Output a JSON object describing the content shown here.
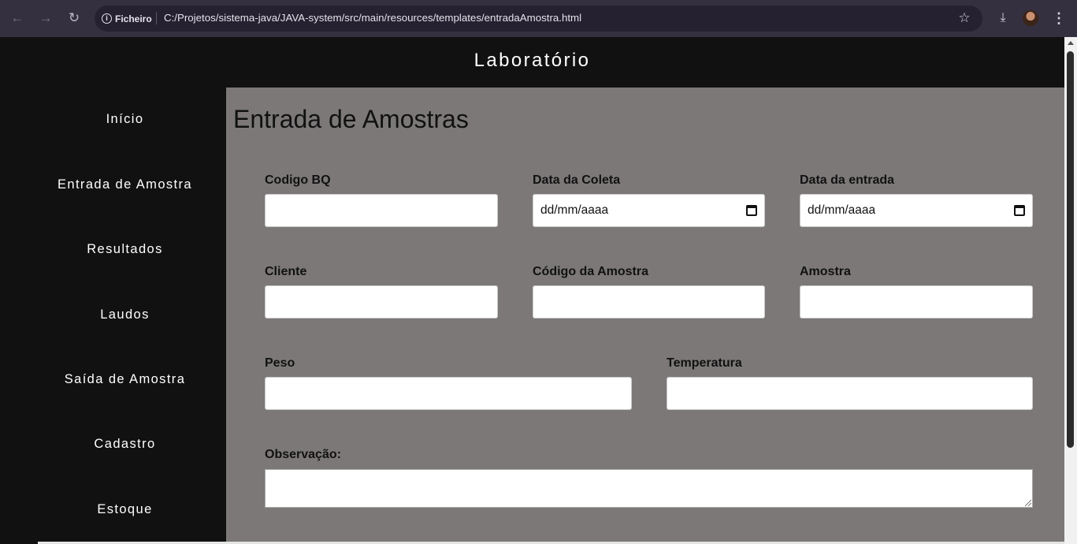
{
  "browser": {
    "site_chip": "Ficheiro",
    "url": "C:/Projetos/sistema-java/JAVA-system/src/main/resources/templates/entradaAmostra.html",
    "icons": [
      "back-arrow-icon",
      "forward-arrow-icon",
      "reload-icon",
      "info-icon",
      "star-icon",
      "download-icon",
      "profile-avatar",
      "kebab-menu-icon"
    ]
  },
  "header": {
    "title": "Laboratório"
  },
  "sidebar": {
    "items": [
      {
        "label": "Início"
      },
      {
        "label": "Entrada de Amostra"
      },
      {
        "label": "Resultados"
      },
      {
        "label": "Laudos"
      },
      {
        "label": "Saída de Amostra"
      },
      {
        "label": "Cadastro"
      },
      {
        "label": "Estoque"
      }
    ]
  },
  "main": {
    "title": "Entrada de Amostras",
    "fields": {
      "codigo_bq": {
        "label": "Codigo BQ",
        "value": ""
      },
      "data_coleta": {
        "label": "Data da Coleta",
        "value": "dd/mm/aaaa"
      },
      "data_entrada": {
        "label": "Data da entrada",
        "value": "dd/mm/aaaa"
      },
      "cliente": {
        "label": "Cliente",
        "value": ""
      },
      "codigo_amostra": {
        "label": "Código da Amostra",
        "value": ""
      },
      "amostra": {
        "label": "Amostra",
        "value": ""
      },
      "peso": {
        "label": "Peso",
        "value": ""
      },
      "temperatura": {
        "label": "Temperatura",
        "value": ""
      },
      "observacao": {
        "label": "Observação:",
        "value": ""
      }
    }
  },
  "colors": {
    "chrome_bg": "#35303f",
    "omnibox_bg": "#252130",
    "page_bg": "#111111",
    "content_bg": "#7c7878",
    "text_dark": "#111111",
    "text_light": "#ffffff"
  }
}
